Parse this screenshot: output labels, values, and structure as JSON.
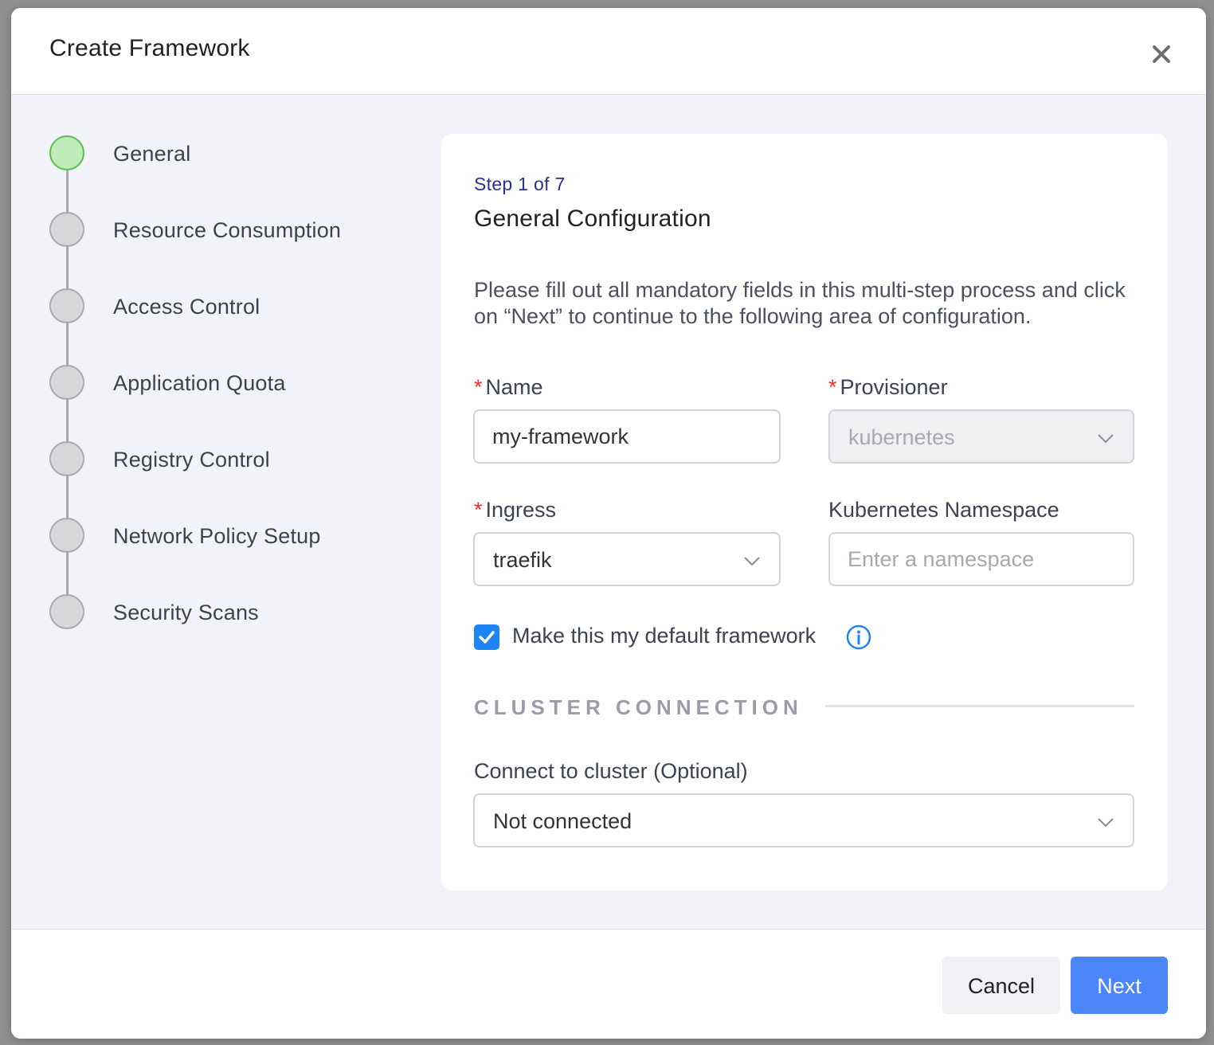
{
  "modal": {
    "title": "Create Framework"
  },
  "stepper": {
    "steps": [
      {
        "label": "General",
        "state": "active"
      },
      {
        "label": "Resource Consumption",
        "state": "inactive"
      },
      {
        "label": "Access Control",
        "state": "inactive"
      },
      {
        "label": "Application Quota",
        "state": "inactive"
      },
      {
        "label": "Registry Control",
        "state": "inactive"
      },
      {
        "label": "Network Policy Setup",
        "state": "inactive"
      },
      {
        "label": "Security Scans",
        "state": "inactive"
      }
    ]
  },
  "card": {
    "step_counter": "Step 1 of 7",
    "title": "General Configuration",
    "description": "Please fill out all mandatory fields in this multi-step process and click on “Next” to continue to the following area of configuration.",
    "fields": {
      "name": {
        "label": "Name",
        "required_mark": "*",
        "value": "my-framework"
      },
      "provisioner": {
        "label": "Provisioner",
        "required_mark": "*",
        "value": "kubernetes",
        "disabled": true
      },
      "ingress": {
        "label": "Ingress",
        "required_mark": "*",
        "value": "traefik"
      },
      "namespace": {
        "label": "Kubernetes Namespace",
        "value": "",
        "placeholder": "Enter a namespace"
      }
    },
    "default_checkbox": {
      "label": "Make this my default framework",
      "checked": true
    },
    "cluster_section": {
      "title": "CLUSTER CONNECTION",
      "connect_label": "Connect to cluster (Optional)",
      "connect_value": "Not connected"
    }
  },
  "footer": {
    "cancel_label": "Cancel",
    "next_label": "Next"
  },
  "colors": {
    "accent": "#4a86f7",
    "checkbox": "#1f84f5",
    "step_active_fill": "#bdecb8",
    "step_active_border": "#5cbb52",
    "required": "#e2352a",
    "step_counter": "#2a2f8f"
  },
  "icons": {
    "close": "close-icon",
    "chevron": "chevron-down-icon",
    "check": "check-icon",
    "info": "info-icon"
  }
}
